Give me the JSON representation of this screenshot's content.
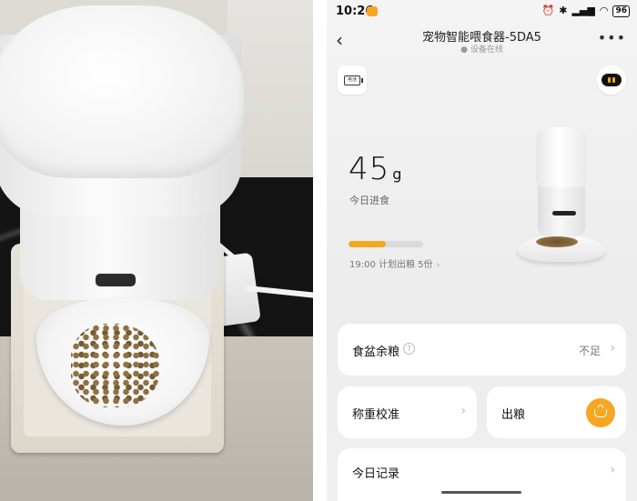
{
  "status_bar": {
    "time": "10:26",
    "battery": "96"
  },
  "header": {
    "title": "宠物智能喂食器-5DA5",
    "subtitle": "设备在线",
    "back_icon": "chevron-left-icon",
    "more_icon": "more-horizontal-icon"
  },
  "top_buttons": {
    "left_icon": "battery-icon",
    "left_icon_text": "电池",
    "right_icon": "pet-face-icon"
  },
  "feeding": {
    "amount_value": "45",
    "amount_unit": "g",
    "amount_label": "今日进食",
    "progress_fraction": 0.5,
    "plan_text": "19:00 计划出粮 5份"
  },
  "cards": {
    "bowl_remaining": {
      "label": "食盆余粮",
      "value": "不足"
    },
    "calibrate": {
      "label": "称重校准"
    },
    "dispense": {
      "label": "出粮"
    },
    "today_record": {
      "label": "今日记录"
    }
  },
  "colors": {
    "accent": "#f5a623",
    "card_bg": "#ffffff",
    "page_bg": "#ececec"
  }
}
